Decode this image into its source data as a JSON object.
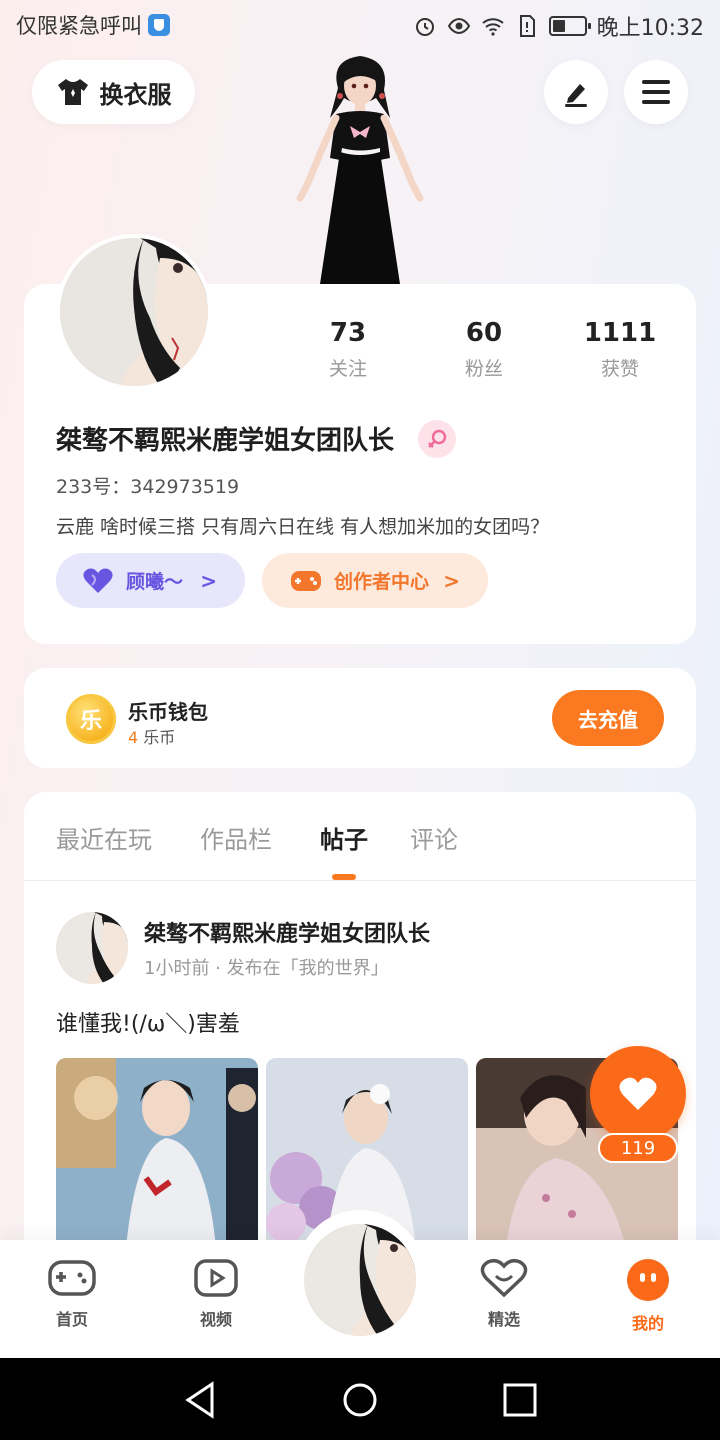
{
  "status_bar": {
    "carrier_text": "仅限紧急呼叫",
    "time": "晚上10:32"
  },
  "header": {
    "outfit_label": "换衣服",
    "edit_icon": "pen-icon",
    "menu_icon": "hamburger-menu-icon"
  },
  "profile": {
    "stats": [
      {
        "value": "73",
        "label": "关注"
      },
      {
        "value": "60",
        "label": "粉丝"
      },
      {
        "value": "1111",
        "label": "获赞"
      }
    ],
    "username": "桀骜不羁熙米鹿学姐女团队长",
    "gender": "female",
    "uid": "233号：342973519",
    "bio": "云鹿 啥时候三搭 只有周六日在线 有人想加米加的女团吗？",
    "tags": [
      {
        "label": "顾曦～",
        "color": "#6a55e0",
        "icon": "heart-icon"
      },
      {
        "label": "创作者中心",
        "color": "#f2762c",
        "icon": "gamepad-icon"
      }
    ]
  },
  "wallet": {
    "title": "乐币钱包",
    "coin_glyph": "乐",
    "amount": "4",
    "unit": "乐币",
    "recharge_label": "去充值"
  },
  "tabs": [
    {
      "label": "最近在玩",
      "active": false
    },
    {
      "label": "作品栏",
      "active": false
    },
    {
      "label": "帖子",
      "active": true
    },
    {
      "label": "评论",
      "active": false
    }
  ],
  "post": {
    "author": "桀骜不羁熙米鹿学姐女团队长",
    "meta": "1小时前 · 发布在「我的世界」",
    "text": "谁懂我!(/ω＼)害羞",
    "like_count": "119"
  },
  "bottom_nav": [
    {
      "label": "首页",
      "icon": "gamepad-icon",
      "active": false
    },
    {
      "label": "视频",
      "icon": "play-icon",
      "active": false
    },
    {
      "label": "精选",
      "icon": "heart-smile-icon",
      "active": false
    },
    {
      "label": "我的",
      "icon": "face-icon",
      "active": true
    }
  ],
  "colors": {
    "accent": "#fb7a21",
    "purple": "#6a55e0"
  }
}
